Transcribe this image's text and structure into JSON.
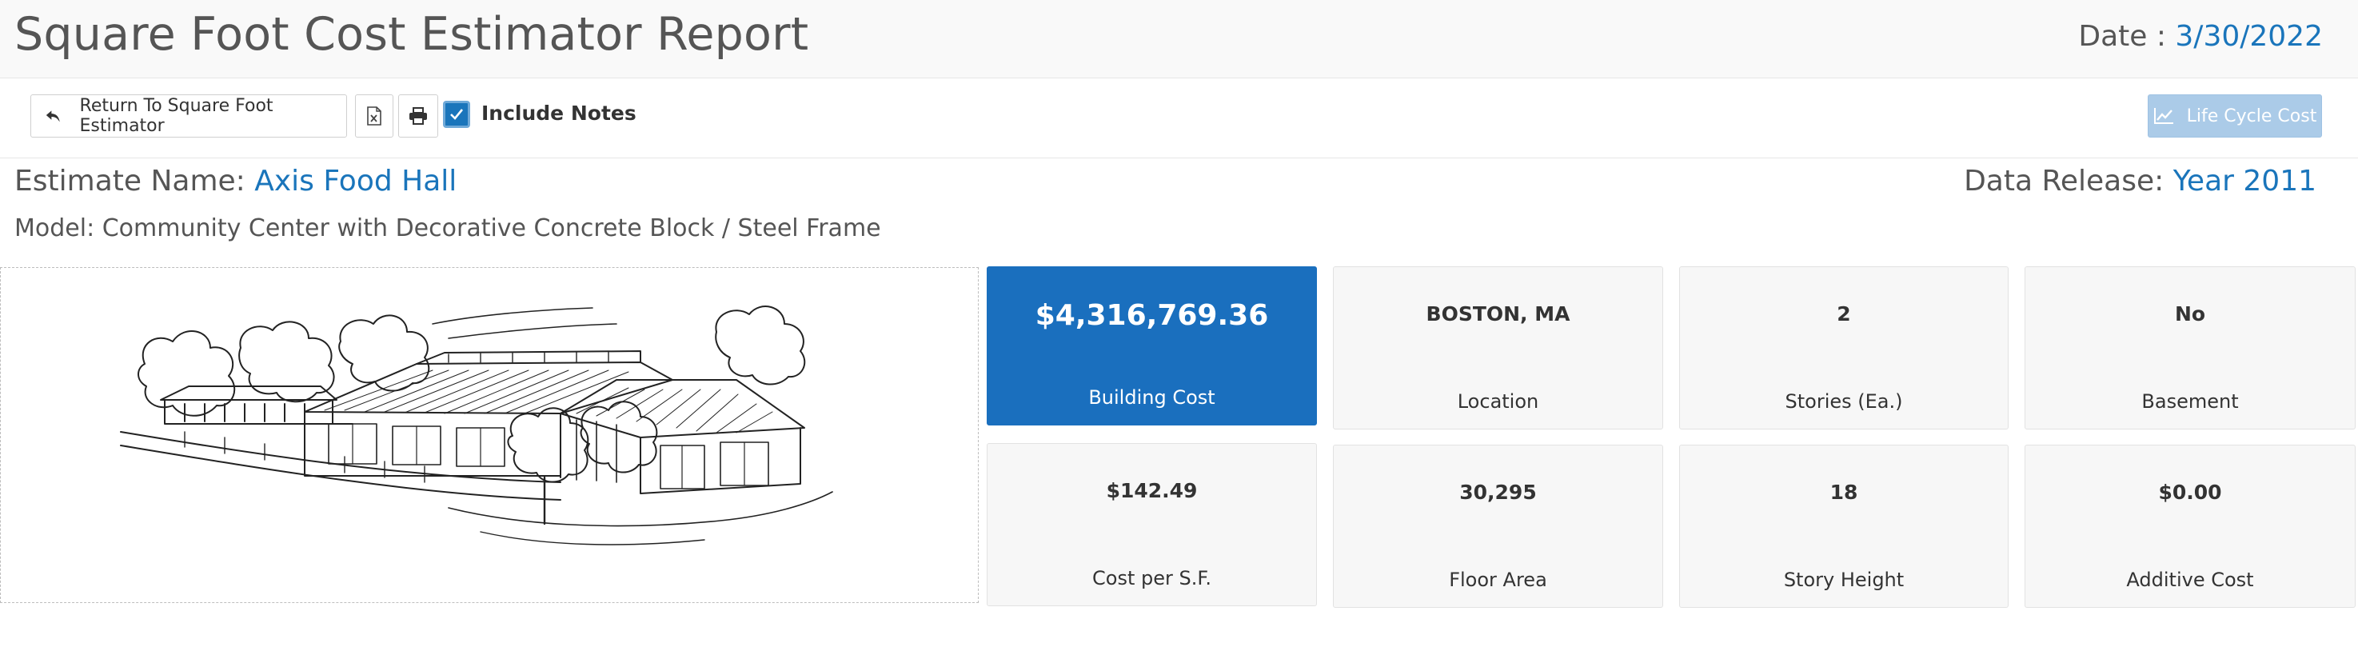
{
  "header": {
    "title": "Square Foot Cost Estimator Report",
    "date_label": "Date : ",
    "date_value": "3/30/2022"
  },
  "toolbar": {
    "return_label": "Return To Square Foot Estimator",
    "include_notes_label": "Include Notes",
    "include_notes_checked": true,
    "life_cycle_label": "Life Cycle Cost"
  },
  "estimate": {
    "name_label": "Estimate Name: ",
    "name_value": "Axis Food Hall",
    "release_label": "Data Release: ",
    "release_value": "Year 2011",
    "model_text": "Model: Community Center with Decorative Concrete Block / Steel Frame"
  },
  "tiles": [
    {
      "value": "$4,316,769.36",
      "label": "Building Cost"
    },
    {
      "value": "BOSTON, MA",
      "label": "Location"
    },
    {
      "value": "2",
      "label": "Stories (Ea.)"
    },
    {
      "value": "No",
      "label": "Basement"
    },
    {
      "value": "$142.49",
      "label": "Cost per S.F."
    },
    {
      "value": "30,295",
      "label": "Floor Area"
    },
    {
      "value": "18",
      "label": "Story Height"
    },
    {
      "value": "$0.00",
      "label": "Additive Cost"
    }
  ],
  "colors": {
    "accent": "#1a75bb",
    "primary_tile": "#1a6fbe",
    "disabled_button": "#abcbe8"
  },
  "icons": {
    "return": "reply-arrow-icon",
    "excel": "excel-file-icon",
    "print": "printer-icon",
    "check": "checkmark-icon",
    "life_cycle": "line-chart-icon"
  }
}
